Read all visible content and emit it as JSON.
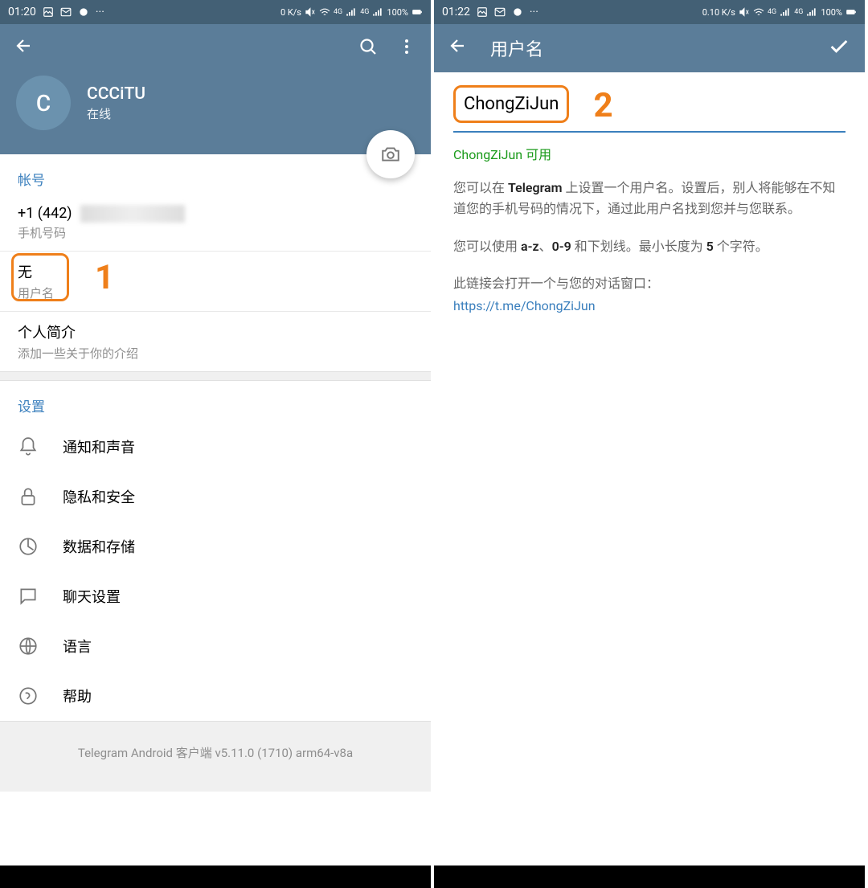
{
  "colors": {
    "header": "#5b7d99",
    "accent": "#3a7fbd",
    "highlight": "#ef7f1a"
  },
  "left": {
    "statusbar": {
      "time": "01:20",
      "network": "0 K/s",
      "signal": "4G",
      "battery": "100%"
    },
    "profile": {
      "avatar_initial": "C",
      "name": "CCCiTU",
      "status": "在线"
    },
    "account": {
      "section_label": "帐号",
      "phone": {
        "value": "+1 (442)",
        "label": "手机号码"
      },
      "username": {
        "value": "无",
        "label": "用户名"
      },
      "bio": {
        "value": "个人简介",
        "label": "添加一些关于你的介绍"
      }
    },
    "settings": {
      "section_label": "设置",
      "items": [
        {
          "label": "通知和声音",
          "icon": "bell-icon"
        },
        {
          "label": "隐私和安全",
          "icon": "lock-icon"
        },
        {
          "label": "数据和存储",
          "icon": "data-icon"
        },
        {
          "label": "聊天设置",
          "icon": "chat-icon"
        },
        {
          "label": "语言",
          "icon": "globe-icon"
        },
        {
          "label": "帮助",
          "icon": "help-icon"
        }
      ]
    },
    "footer": "Telegram Android 客户端 v5.11.0 (1710) arm64-v8a",
    "callout": "1"
  },
  "right": {
    "statusbar": {
      "time": "01:22",
      "network": "0.10 K/s",
      "signal": "4G",
      "battery": "100%"
    },
    "header_title": "用户名",
    "username_value": "ChongZiJun",
    "available_text": "ChongZiJun 可用",
    "desc1_prefix": "您可以在 ",
    "desc1_bold": "Telegram",
    "desc1_suffix": " 上设置一个用户名。设置后，别人将能够在不知道您的手机号码的情况下，通过此用户名找到您并与您联系。",
    "desc2_prefix": "您可以使用 ",
    "desc2_b1": "a-z",
    "desc2_m1": "、",
    "desc2_b2": "0-9",
    "desc2_m2": " 和下划线。最小长度为 ",
    "desc2_b3": "5",
    "desc2_suffix": " 个字符。",
    "desc3": "此链接会打开一个与您的对话窗口：",
    "link": "https://t.me/ChongZiJun",
    "callout": "2"
  }
}
